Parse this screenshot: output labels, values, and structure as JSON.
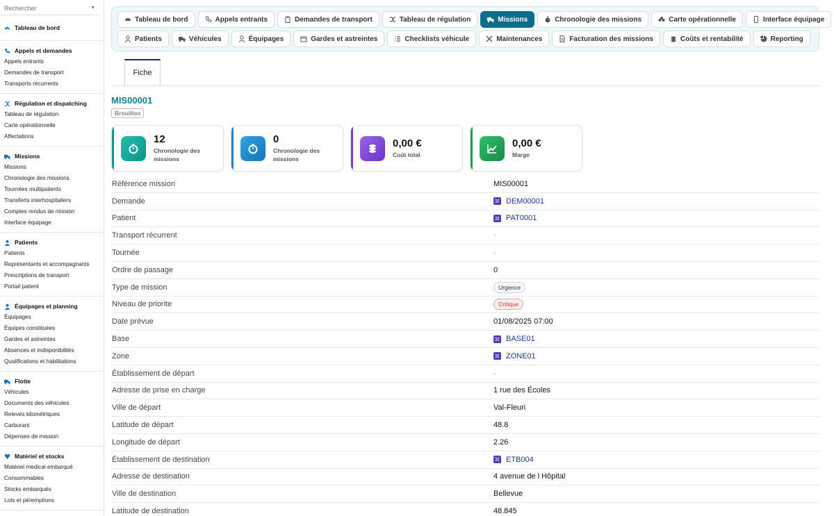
{
  "sidebar": {
    "search_placeholder": "Rechercher",
    "dashboard": "Tableau de bord",
    "sections": [
      {
        "title": "Appels et demandes",
        "items": [
          "Appels entrants",
          "Demandes de transport",
          "Transports récurrents"
        ]
      },
      {
        "title": "Régulation et dispatching",
        "items": [
          "Tableau de régulation",
          "Carte opérationnelle",
          "Affectations"
        ]
      },
      {
        "title": "Missions",
        "items": [
          "Missions",
          "Chronologie des missions",
          "Tournées multipatients",
          "Transferts interhospitaliers",
          "Comptes rendus de mission",
          "Interface équipage"
        ]
      },
      {
        "title": "Patients",
        "items": [
          "Patients",
          "Représentants et accompagnants",
          "Prescriptions de transport",
          "Portail patient"
        ]
      },
      {
        "title": "Équipages et planning",
        "items": [
          "Équipages",
          "Équipes constituées",
          "Gardes et astreintes",
          "Absences et indisponibilités",
          "Qualifications et habilitations"
        ]
      },
      {
        "title": "Flotte",
        "items": [
          "Véhicules",
          "Documents des véhicules",
          "Relevés kilométriques",
          "Carburant",
          "Dépenses de mission"
        ]
      },
      {
        "title": "Matériel et stocks",
        "items": [
          "Matériel medical embarqué",
          "Consommables",
          "Stocks embarqués",
          "Lots et péremptions"
        ]
      }
    ]
  },
  "nav": {
    "row1": [
      "Tableau de bord",
      "Appels entrants",
      "Demandes de transport",
      "Tableau de régulation",
      "Missions",
      "Chronologie des missions",
      "Carte opérationnelle",
      "Interface équipage"
    ],
    "row2": [
      "Patients",
      "Véhicules",
      "Équipages",
      "Gardes et astreintes",
      "Checklists véhicule",
      "Maintenances",
      "Facturation des missions",
      "Coûts et rentabilité",
      "Reporting"
    ],
    "active": "Missions"
  },
  "tab": "Fiche",
  "record": {
    "id": "MIS00001",
    "status": "Brouillon"
  },
  "cards": [
    {
      "value": "12",
      "label": "Chronologie des missions"
    },
    {
      "value": "0",
      "label": "Chronologie des missions"
    },
    {
      "value": "0,00 €",
      "label": "Coût total"
    },
    {
      "value": "0,00 €",
      "label": "Marge"
    }
  ],
  "fields": [
    {
      "label": "Référence mission",
      "value": "MIS00001",
      "kind": "text"
    },
    {
      "label": "Demande",
      "value": "DEM00001",
      "kind": "link"
    },
    {
      "label": "Patient",
      "value": "PAT0001",
      "kind": "link"
    },
    {
      "label": "Transport récurrent",
      "value": "-",
      "kind": "empty"
    },
    {
      "label": "Tournée",
      "value": "-",
      "kind": "empty"
    },
    {
      "label": "Ordre de passage",
      "value": "0",
      "kind": "text"
    },
    {
      "label": "Type de mission",
      "value": "Urgence",
      "kind": "pill"
    },
    {
      "label": "Niveau de priorite",
      "value": "Critique",
      "kind": "pill-red"
    },
    {
      "label": "Date prévue",
      "value": "01/08/2025 07:00",
      "kind": "text"
    },
    {
      "label": "Base",
      "value": "BASE01",
      "kind": "link"
    },
    {
      "label": "Zone",
      "value": "ZONE01",
      "kind": "link"
    },
    {
      "label": "Établissement de départ",
      "value": "-",
      "kind": "empty"
    },
    {
      "label": "Adresse de prise en charge",
      "value": "1 rue des Écoles",
      "kind": "text"
    },
    {
      "label": "Ville de départ",
      "value": "Val-Fleuri",
      "kind": "text"
    },
    {
      "label": "Latitude de départ",
      "value": "48.8",
      "kind": "text"
    },
    {
      "label": "Longitude de départ",
      "value": "2.26",
      "kind": "text"
    },
    {
      "label": "Établissement de destination",
      "value": "ETB004",
      "kind": "link"
    },
    {
      "label": "Adresse de destination",
      "value": "4 avenue de l Hôpital",
      "kind": "text"
    },
    {
      "label": "Ville de destination",
      "value": "Bellevue",
      "kind": "text"
    },
    {
      "label": "Latitude de destination",
      "value": "48.845",
      "kind": "text"
    }
  ],
  "colors": {
    "accent": "#157f8f",
    "active_nav": "#0d6d8c",
    "link": "#1a3b8f"
  }
}
